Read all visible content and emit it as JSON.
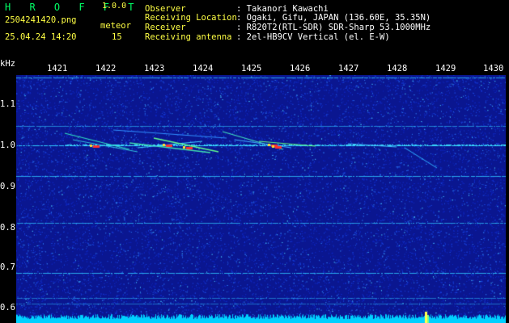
{
  "header": {
    "app_name": "H R O F F T",
    "app_version": "1.0.0",
    "filename": "2504241420.png",
    "datetime": "25.04.24 14:20",
    "meteor_label": "meteor",
    "meteor_count": "15",
    "fields": [
      {
        "label": "Observer",
        "value": ": Takanori Kawachi"
      },
      {
        "label": "Receiving Location",
        "value": ": Ogaki, Gifu, JAPAN (136.60E, 35.35N)"
      },
      {
        "label": "Receiver",
        "value": ": R820T2(RTL-SDR) SDR-Sharp 53.1000MHz"
      },
      {
        "label": "Receiving antenna",
        "value": ": 2el-HB9CV Vertical (el. E-W)"
      }
    ]
  },
  "spectrogram": {
    "y_unit": "kHz",
    "y_ticks": [
      "1.1",
      "1.0",
      "0.9",
      "0.8",
      "0.7",
      "0.6"
    ],
    "x_ticks": [
      "1421",
      "1422",
      "1423",
      "1424",
      "1425",
      "1426",
      "1427",
      "1428",
      "1429",
      "1430"
    ]
  },
  "colors": {
    "background": "#000000",
    "noise_base": "#0b1aa0",
    "carrier": "#00e0ff",
    "meteor_hot": "#ff3030",
    "bottom_band": "#00d8ff",
    "title_green": "#00ff66",
    "header_yellow": "#ffff44"
  }
}
